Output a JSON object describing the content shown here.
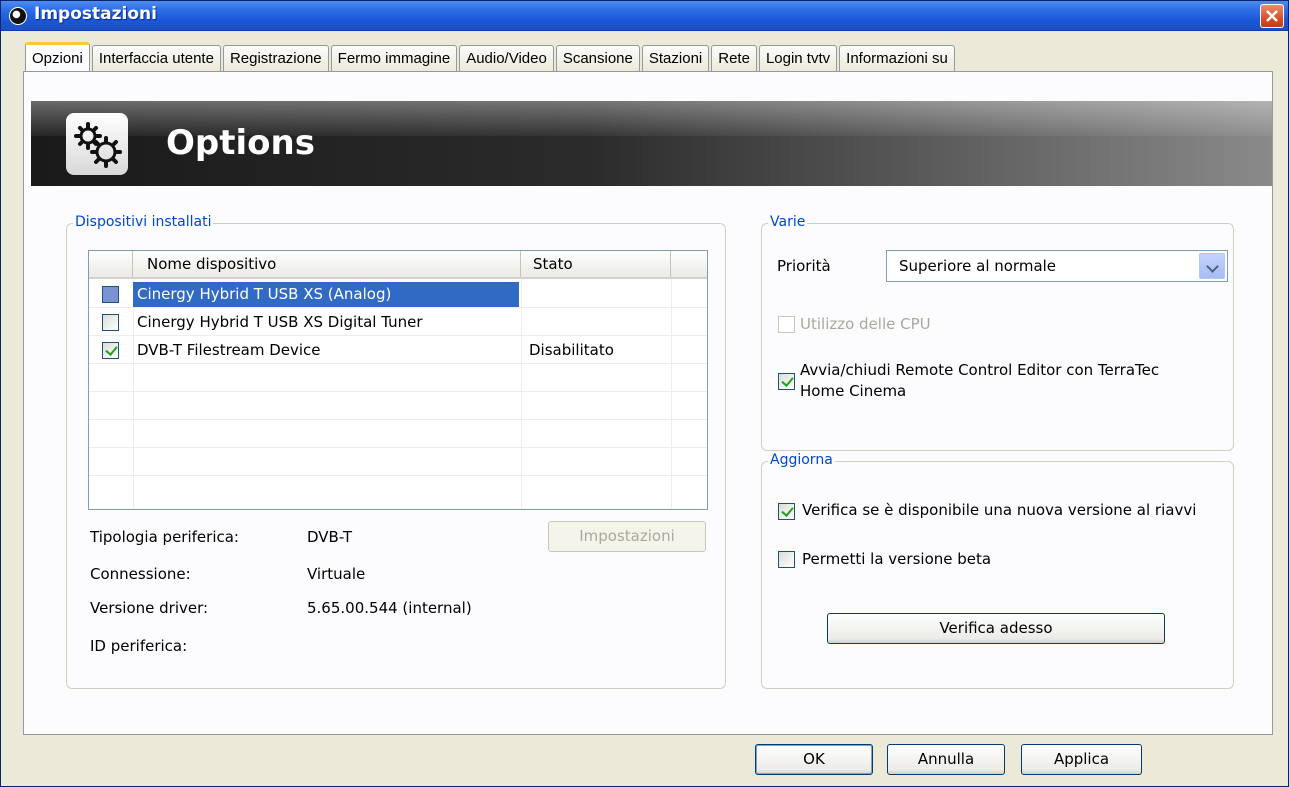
{
  "window": {
    "title": "Impostazioni"
  },
  "tabs": [
    {
      "label": "Opzioni",
      "active": true
    },
    {
      "label": "Interfaccia utente"
    },
    {
      "label": "Registrazione"
    },
    {
      "label": "Fermo immagine"
    },
    {
      "label": "Audio/Video"
    },
    {
      "label": "Scansione"
    },
    {
      "label": "Stazioni"
    },
    {
      "label": "Rete"
    },
    {
      "label": "Login tvtv"
    },
    {
      "label": "Informazioni su"
    }
  ],
  "banner": {
    "title": "Options",
    "icon": "gears-icon"
  },
  "devices": {
    "group_label": "Dispositivi installati",
    "columns": [
      "Nome dispositivo",
      "Stato"
    ],
    "rows": [
      {
        "name": "Cinergy Hybrid T USB XS (Analog)",
        "state": "",
        "checked": false,
        "selected": true
      },
      {
        "name": "Cinergy Hybrid T USB XS Digital Tuner",
        "state": "",
        "checked": false,
        "selected": false
      },
      {
        "name": "DVB-T Filestream Device",
        "state": "Disabilitato",
        "checked": true,
        "selected": false
      }
    ],
    "settings_button": "Impostazioni",
    "info": [
      {
        "label": "Tipologia periferica:",
        "value": "DVB-T"
      },
      {
        "label": "Connessione:",
        "value": "Virtuale"
      },
      {
        "label": "Versione driver:",
        "value": "5.65.00.544 (internal)"
      },
      {
        "label": "ID periferica:",
        "value": ""
      }
    ]
  },
  "varie": {
    "group_label": "Varie",
    "priority_label": "Priorità",
    "priority_value": "Superiore al normale",
    "cpu_label": "Utilizzo delle CPU",
    "remote_label_line1": "Avvia/chiudi Remote Control Editor con TerraTec",
    "remote_label_line2": "Home Cinema"
  },
  "aggiorna": {
    "group_label": "Aggiorna",
    "check_label": "Verifica se è disponibile una nuova versione al riavvi",
    "beta_label": "Permetti la versione beta",
    "check_now_button": "Verifica adesso"
  },
  "footer": {
    "ok": "OK",
    "cancel": "Annulla",
    "apply": "Applica"
  }
}
